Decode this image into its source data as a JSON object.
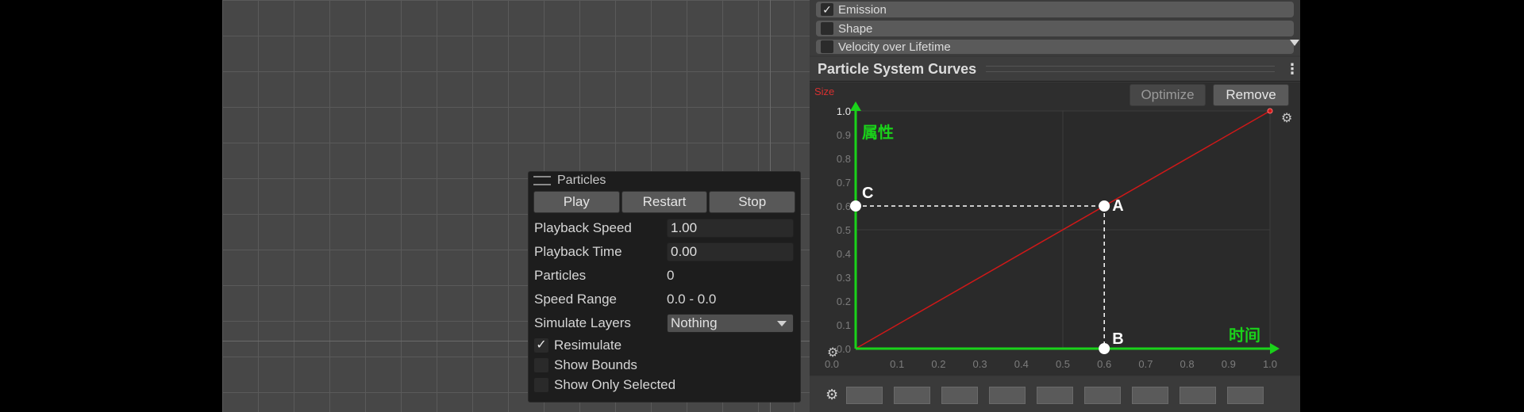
{
  "scene": {},
  "particles_panel": {
    "title": "Particles",
    "buttons": {
      "play": "Play",
      "restart": "Restart",
      "stop": "Stop"
    },
    "rows": {
      "playback_speed": {
        "label": "Playback Speed",
        "value": "1.00"
      },
      "playback_time": {
        "label": "Playback Time",
        "value": "0.00"
      },
      "particles": {
        "label": "Particles",
        "value": "0"
      },
      "speed_range": {
        "label": "Speed Range",
        "value": "0.0 - 0.0"
      },
      "simulate_layers": {
        "label": "Simulate Layers",
        "value": "Nothing"
      }
    },
    "checks": {
      "resimulate": {
        "label": "Resimulate",
        "checked": true,
        "mark": "✓"
      },
      "show_bounds": {
        "label": "Show Bounds",
        "checked": false
      },
      "show_only_selected": {
        "label": "Show Only Selected",
        "checked": false
      }
    }
  },
  "modules": [
    {
      "label": "Emission",
      "checked": true,
      "mark": "✓"
    },
    {
      "label": "Shape",
      "checked": false
    },
    {
      "label": "Velocity over Lifetime",
      "checked": false
    }
  ],
  "curves": {
    "title": "Particle System Curves",
    "property": "Size",
    "optimize_label": "Optimize",
    "remove_label": "Remove",
    "curve_color": "#d01818",
    "annotation_color": "#1ad21a",
    "chart_data": {
      "type": "line",
      "x_ticks": [
        "0.0",
        "0.1",
        "0.2",
        "0.3",
        "0.4",
        "0.5",
        "0.6",
        "0.7",
        "0.8",
        "0.9",
        "1.0"
      ],
      "y_ticks": [
        "0.0",
        "0.1",
        "0.2",
        "0.3",
        "0.4",
        "0.5",
        "0.6",
        "0.7",
        "0.8",
        "0.9",
        "1.0"
      ],
      "xlim": [
        0.0,
        1.0
      ],
      "ylim": [
        0.0,
        1.0
      ],
      "curve": {
        "x": [
          0.0,
          1.0
        ],
        "y": [
          0.0,
          1.0
        ]
      },
      "annotation": {
        "y_axis_label": "属性",
        "x_axis_label": "时间",
        "point_a": {
          "label": "A",
          "x": 0.6,
          "y": 0.6
        },
        "point_b": {
          "label": "B",
          "x": 0.6,
          "y": 0.0
        },
        "point_c": {
          "label": "C",
          "x": 0.0,
          "y": 0.6
        }
      }
    }
  },
  "presets": {
    "count": 9
  }
}
